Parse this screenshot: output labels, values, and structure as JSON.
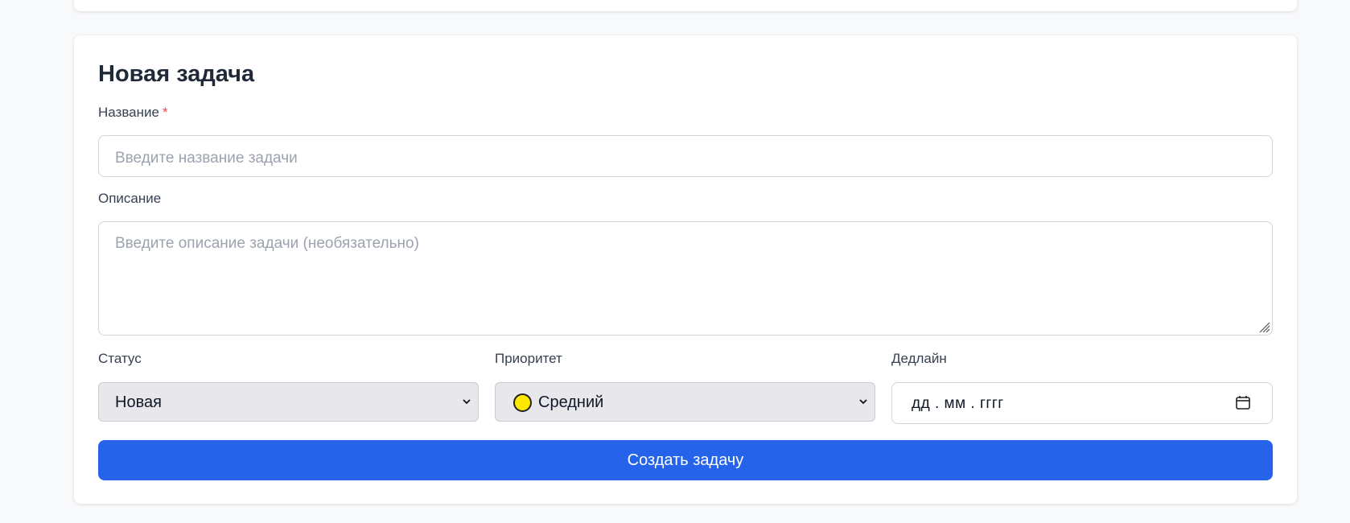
{
  "form": {
    "title": "Новая задача",
    "name_label": "Название",
    "required_mark": "*",
    "name_placeholder": "Введите название задачи",
    "description_label": "Описание",
    "description_placeholder": "Введите описание задачи (необязательно)",
    "status_label": "Статус",
    "status_value": "Новая",
    "priority_label": "Приоритет",
    "priority_value": "Средний",
    "priority_color": "#ffe800",
    "deadline_label": "Дедлайн",
    "deadline_placeholder": "дд . мм . гггг",
    "submit_label": "Создать задачу"
  },
  "colors": {
    "accent": "#2563eb",
    "required": "#ef4444"
  },
  "icons": {
    "status_dropdown": "chevron-down-icon",
    "priority_dropdown": "chevron-down-icon",
    "deadline_picker": "calendar-icon",
    "priority_indicator": "yellow-circle-icon"
  }
}
